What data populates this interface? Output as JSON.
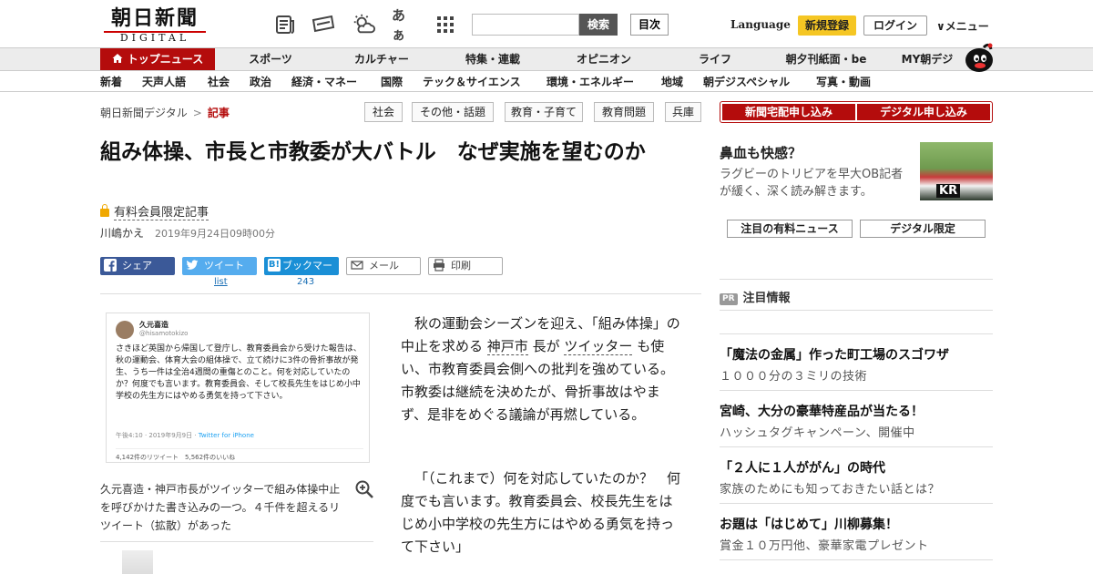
{
  "header": {
    "logo_main": "朝日新聞",
    "logo_sub": "DIGITAL",
    "search_placeholder": "",
    "search_label": "検索",
    "mokuji_label": "目次",
    "lang_label": "Language",
    "register_label": "新規登録",
    "login_label": "ログイン",
    "menu_label": "∨メニュー",
    "icon_kana": "あぁ"
  },
  "nav1": {
    "top_label": "トップニュース",
    "items": [
      "スポーツ",
      "カルチャー",
      "特集・連載",
      "オピニオン",
      "ライフ",
      "朝夕刊紙面・be",
      "MY朝デジ"
    ]
  },
  "nav2": {
    "items": [
      "新着",
      "天声人語",
      "社会",
      "政治",
      "経済・マネー",
      "国際",
      "テック＆サイエンス",
      "環境・エネルギー",
      "地域",
      "朝デジスペシャル",
      "写真・動画"
    ]
  },
  "breadcrumb": {
    "home": "朝日新聞デジタル",
    "sep": ">",
    "current": "記事"
  },
  "tags": [
    "社会",
    "その他・話題",
    "教育・子育て",
    "教育問題",
    "兵庫"
  ],
  "subscribe": {
    "delivery": "新聞宅配申し込み",
    "digital": "デジタル申し込み"
  },
  "article": {
    "title": "組み体操、市長と市教委が大バトル　なぜ実施を望むのか",
    "members_only": "有料会員限定記事",
    "author": "川嶋かえ",
    "date": "2019年9月24日09時00分",
    "share": {
      "facebook": "シェア",
      "twitter": "ツイート",
      "twitter_sub": "list",
      "hatena_mark": "B!",
      "hatena": "ブックマーク",
      "hatena_count": "243",
      "mail": "メール",
      "print": "印刷"
    },
    "tweet": {
      "name": "久元喜造",
      "handle": "@hisamotokizo",
      "text": "さきほど英国から帰国して登庁し、教育委員会から受けた報告は、秋の運動会、体育大会の組体操で、立て続けに3件の骨折事故が発生、うち一件は全治4週間の重傷とのこと。何を対応していたのか？何度でも言います。教育委員会、そして校長先生をはじめ小中学校の先生方にはやめる勇気を持って下さい。",
      "time": "午後4:10 · 2019年9月9日 · ",
      "client": "Twitter for iPhone",
      "stats": "4,142件のリツイート　5,562件のいいね"
    },
    "caption": "久元喜造・神戸市長がツイッターで組み体操中止を呼びかけた書き込みの一つ。４千件を超えるリツイート（拡散）があった",
    "p1_a": "秋の運動会シーズンを迎え、「組み体操」の中止を求める",
    "p1_link1": "神戸市",
    "p1_b": "長が",
    "p1_link2": "ツイッター",
    "p1_c": "も使い、市教育委員会側への批判を強めている。市教委は継続を決めたが、骨折事故はやまず、是非をめぐる議論が再燃している。",
    "p2": "「（これまで）何を対応していたのか？　何度でも言います。教育委員会、校長先生をはじめ小中学校の先生方にはやめる勇気を持って下さい」"
  },
  "sidebar": {
    "promo_title": "鼻血も快感？",
    "promo_desc": "ラグビーのトリビアを早大OB記者が緩く、深く読み解きます。",
    "photo_text": "KR",
    "tab1": "注目の有料ニュース",
    "tab2": "デジタル限定",
    "pr_badge": "PR",
    "pr_head": "注目情報",
    "pr_items": [
      {
        "title": "「魔法の金属」作った町工場のスゴワザ",
        "desc": "１０００分の３ミリの技術"
      },
      {
        "title": "宮崎、大分の豪華特産品が当たる！",
        "desc": "ハッシュタグキャンペーン、開催中"
      },
      {
        "title": "「２人に１人ががん」の時代",
        "desc": "家族のためにも知っておきたい話とは？"
      },
      {
        "title": "お題は「はじめて」川柳募集！",
        "desc": "賞金１０万円他、豪華家電プレゼント"
      }
    ]
  },
  "colors": {
    "brand_red": "#b40c0c",
    "register_yellow": "#f5c623",
    "facebook": "#3b5998",
    "twitter": "#55acee",
    "hatena": "#1a8fd6"
  }
}
